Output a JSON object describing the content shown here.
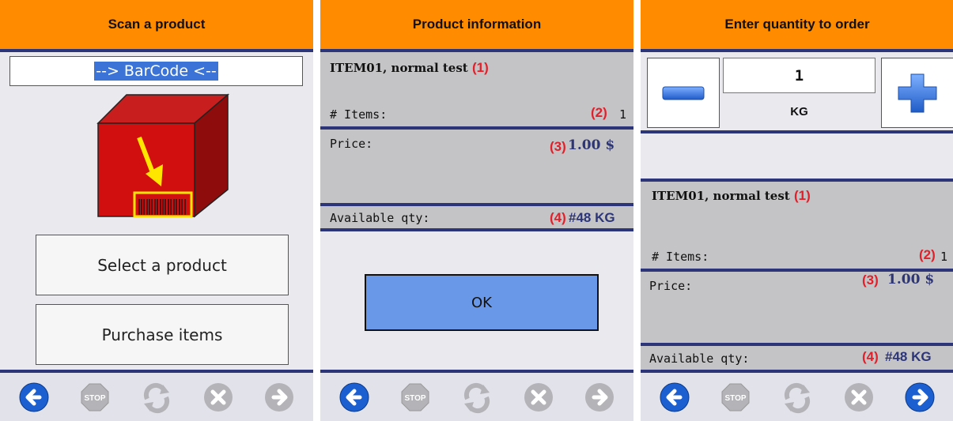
{
  "screens": [
    {
      "title": "Scan a product",
      "barcode_value": "--> BarCode <--",
      "buttons": {
        "select": "Select a product",
        "purchase": "Purchase items"
      }
    },
    {
      "title": "Product information",
      "product_name": "ITEM01, normal test",
      "callouts": {
        "name": "(1)",
        "items": "(2)",
        "price": "(3)",
        "qty": "(4)"
      },
      "items_label": "# Items:",
      "items_value": "1",
      "price_label": "Price:",
      "price_value": "1.00 $",
      "qty_label": "Available qty:",
      "qty_value": "#48 KG",
      "ok_label": "OK"
    },
    {
      "title": "Enter quantity to order",
      "quantity": "1",
      "unit": "KG",
      "product_name": "ITEM01, normal test",
      "callouts": {
        "name": "(1)",
        "items": "(2)",
        "price": "(3)",
        "qty": "(4)"
      },
      "items_label": "# Items:",
      "items_value": "1",
      "price_label": "Price:",
      "price_value": "1.00 $",
      "qty_label": "Available qty:",
      "qty_value": "#48 KG"
    }
  ],
  "nav_icons": [
    "back-arrow-icon",
    "stop-icon",
    "refresh-icon",
    "cancel-icon",
    "forward-arrow-icon"
  ],
  "colors": {
    "header": "#ff8c00",
    "separator": "#2c3577",
    "row_bg": "#c4c4c6",
    "callout": "#e0202a",
    "value": "#2c3577",
    "ok_button": "#6a98e8",
    "nav_active": "#1b5fd0",
    "nav_disabled": "#b4b4b8"
  }
}
